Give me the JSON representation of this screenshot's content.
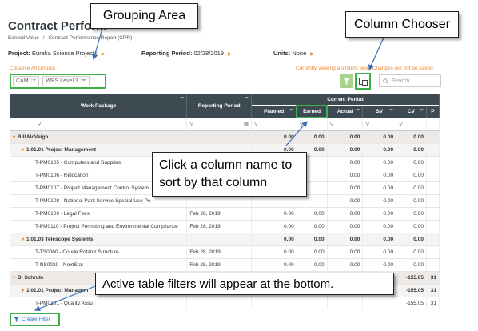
{
  "page": {
    "title": "Contract Perform",
    "breadcrumb": [
      "Earned Value",
      "/",
      "Contract Performance Report (CPR)"
    ]
  },
  "context": {
    "project_label": "Project:",
    "project_value": "Eureka Science Projects",
    "period_label": "Reporting Period:",
    "period_value": "02/28/2019",
    "units_label": "Units:",
    "units_value": "None"
  },
  "toolbar": {
    "collapse_all": "Collapse All Groups",
    "system_view_notice": "Currently viewing a system view. Changes will not be saved.",
    "search_placeholder": "Search...",
    "group_chips": [
      "CAM",
      "WBS Level 3"
    ]
  },
  "grid": {
    "headers": {
      "work_package": "Work Package",
      "reporting_period": "Reporting Period",
      "current_period": "Current Period",
      "planned": "Planned",
      "earned": "Earned",
      "actual": "Actual",
      "sv": "SV",
      "cv": "CV",
      "p": "P"
    },
    "rows": [
      {
        "type": "g1",
        "name": "Bill McVeigh",
        "period": "",
        "planned": "0.00",
        "earned": "0.00",
        "actual": "0.00",
        "sv": "0.00",
        "cv": "0.00",
        "extra": ""
      },
      {
        "type": "g2",
        "name": "1.01.01 Project Management",
        "period": "",
        "planned": "0.00",
        "earned": "0.00",
        "actual": "0.00",
        "sv": "0.00",
        "cv": "0.00",
        "extra": ""
      },
      {
        "type": "row",
        "name": "T-PM0105 - Computers and Supplies",
        "period": "",
        "planned": "",
        "earned": "",
        "actual": "0.00",
        "sv": "0.00",
        "cv": "0.00",
        "extra": ""
      },
      {
        "type": "row",
        "name": "T-PM0106 - Relocation",
        "period": "",
        "planned": "",
        "earned": "",
        "actual": "0.00",
        "sv": "0.00",
        "cv": "0.00",
        "extra": ""
      },
      {
        "type": "row",
        "name": "T-PM0107 - Project Management Control System",
        "period": "",
        "planned": "",
        "earned": "",
        "actual": "0.00",
        "sv": "0.00",
        "cv": "0.00",
        "extra": ""
      },
      {
        "type": "row",
        "name": "T-PM0108 - National Park Service Special Use Pe",
        "period": "",
        "planned": "",
        "earned": "",
        "actual": "0.00",
        "sv": "0.00",
        "cv": "0.00",
        "extra": ""
      },
      {
        "type": "row",
        "name": "T-PM0109 - Legal Fees",
        "period": "Feb 28, 2019",
        "planned": "0.00",
        "earned": "0.00",
        "actual": "0.00",
        "sv": "0.00",
        "cv": "0.00",
        "extra": ""
      },
      {
        "type": "row",
        "name": "T-PM0110 - Project Permitting and Environmental Compliance",
        "period": "Feb 28, 2019",
        "planned": "0.00",
        "earned": "0.00",
        "actual": "0.00",
        "sv": "0.00",
        "cv": "0.00",
        "extra": ""
      },
      {
        "type": "g2",
        "name": "1.01.03 Telescope Systems",
        "period": "",
        "planned": "0.00",
        "earned": "0.00",
        "actual": "0.00",
        "sv": "0.00",
        "cv": "0.00",
        "extra": ""
      },
      {
        "type": "row",
        "name": "T-TS0060 - Coude Rotator Structure",
        "period": "Feb 28, 2019",
        "planned": "0.00",
        "earned": "0.00",
        "actual": "0.00",
        "sv": "0.00",
        "cv": "0.00",
        "extra": ""
      },
      {
        "type": "row",
        "name": "T-NS0020 - NextStar",
        "period": "Feb 28, 2019",
        "planned": "0.00",
        "earned": "0.00",
        "actual": "0.00",
        "sv": "0.00",
        "cv": "0.00",
        "extra": ""
      },
      {
        "type": "g1",
        "name": "D. Schrute",
        "period": "",
        "planned": "",
        "earned": "",
        "actual": "",
        "sv": "",
        "cv": "-155.05",
        "extra": "31"
      },
      {
        "type": "g2",
        "name": "1.01.01 Project Managem",
        "period": "",
        "planned": "",
        "earned": "",
        "actual": "",
        "sv": "",
        "cv": "-155.05",
        "extra": "31"
      },
      {
        "type": "row",
        "name": "T-PM0101 - Quality Assu",
        "period": "",
        "planned": "",
        "earned": "",
        "actual": "",
        "sv": "",
        "cv": "-155.05",
        "extra": "31"
      }
    ]
  },
  "footer": {
    "create_filter": "Create Filter"
  },
  "callouts": {
    "grouping_area": "Grouping Area",
    "column_chooser": "Column Chooser",
    "sort_line1": "Click a column name to",
    "sort_line2": "sort by that column",
    "active_filters": "Active table filters will appear at the bottom."
  },
  "colors": {
    "accent_orange": "#e0822a",
    "highlight_green": "#3bb14a",
    "header_dark": "#3e4a52"
  }
}
